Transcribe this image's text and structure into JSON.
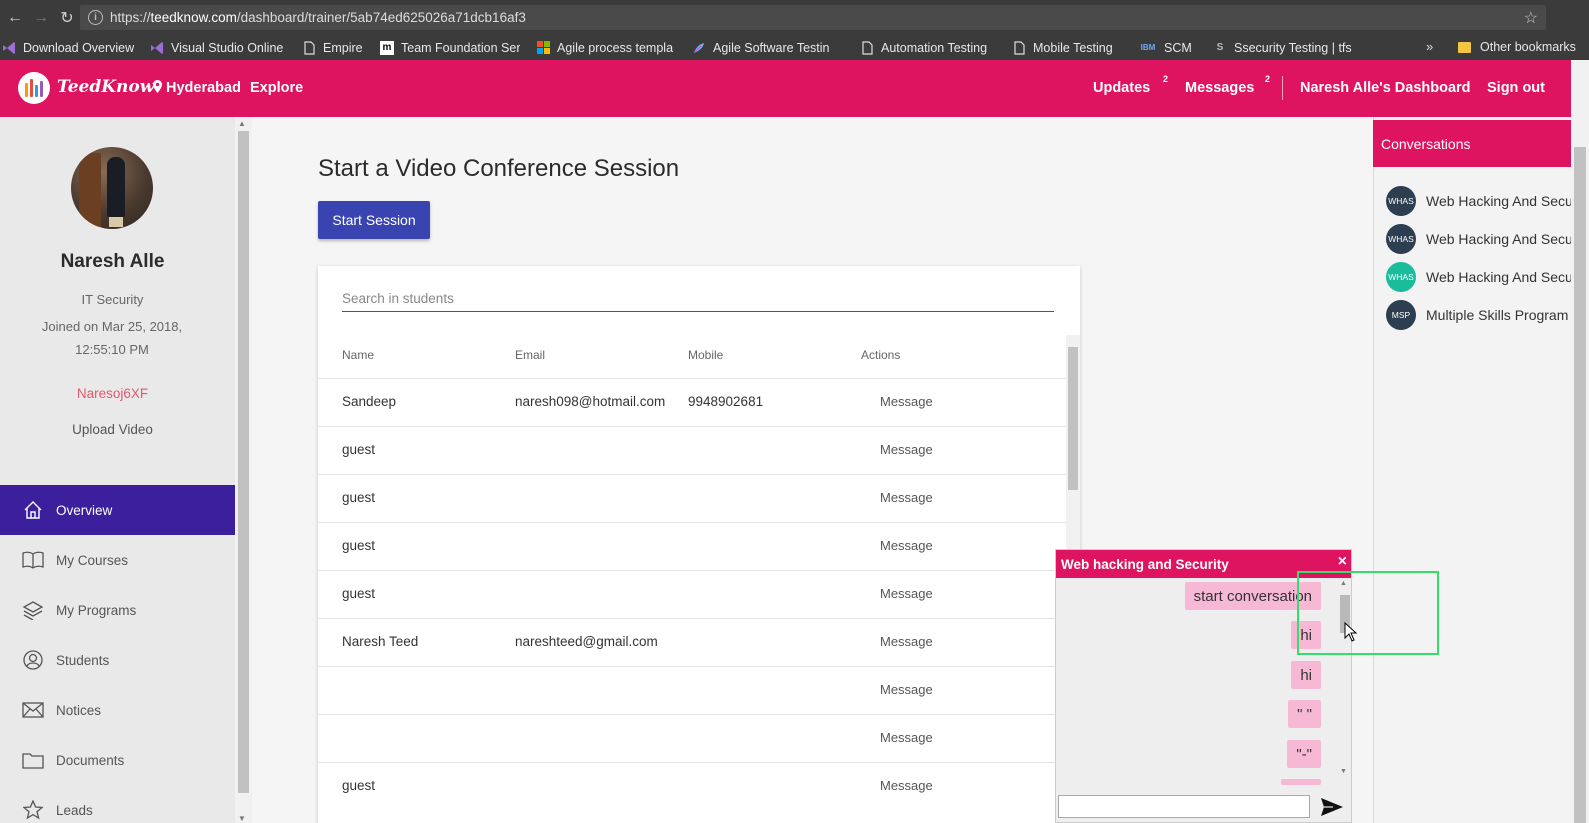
{
  "browser": {
    "url_prefix": "https://",
    "url_domain": "teedknow.com",
    "url_path": "/dashboard/trainer/5ab74ed625026a71dcb16af3",
    "bookmarks": [
      {
        "label": "Download Overview",
        "icon": "visual-studio-icon"
      },
      {
        "label": "Visual Studio Online",
        "icon": "visual-studio-icon"
      },
      {
        "label": "Empire",
        "icon": "page-icon"
      },
      {
        "label": "Team Foundation Ser",
        "icon": "m-logo-icon"
      },
      {
        "label": "Agile process templa",
        "icon": "windows-icon"
      },
      {
        "label": "Agile Software Testin",
        "icon": "feather-icon"
      },
      {
        "label": "Automation Testing",
        "icon": "page-icon"
      },
      {
        "label": "Mobile Testing",
        "icon": "page-icon"
      },
      {
        "label": "SCM",
        "icon": "ibm-icon"
      },
      {
        "label": "Ssecurity Testing | tfs",
        "icon": "s-logo-icon"
      }
    ],
    "more_label": "»",
    "other_bookmarks": "Other bookmarks"
  },
  "header": {
    "brand": "TeedKnow",
    "location": "Hyderabad",
    "explore": "Explore",
    "updates": "Updates",
    "updates_count": "2",
    "messages": "Messages",
    "messages_count": "2",
    "dashboard": "Naresh Alle's Dashboard",
    "signout": "Sign out"
  },
  "profile": {
    "name": "Naresh Alle",
    "role": "IT Security",
    "joined": "Joined on Mar 25, 2018, 12:55:10 PM",
    "code": "Naresoj6XF",
    "upload": "Upload Video"
  },
  "menu": [
    {
      "label": "Overview",
      "icon": "home-icon"
    },
    {
      "label": "My Courses",
      "icon": "book-icon"
    },
    {
      "label": "My Programs",
      "icon": "layers-icon"
    },
    {
      "label": "Students",
      "icon": "user-icon"
    },
    {
      "label": "Notices",
      "icon": "envelope-icon"
    },
    {
      "label": "Documents",
      "icon": "folder-icon"
    },
    {
      "label": "Leads",
      "icon": "star-icon"
    }
  ],
  "main": {
    "title": "Start a Video Conference Session",
    "start_button": "Start Session",
    "search_placeholder": "Search in students",
    "columns": [
      "Name",
      "Email",
      "Mobile",
      "Actions"
    ],
    "rows": [
      {
        "name": "Sandeep",
        "email": "naresh098@hotmail.com",
        "mobile": "9948902681",
        "action": "Message"
      },
      {
        "name": "guest",
        "email": "",
        "mobile": "",
        "action": "Message"
      },
      {
        "name": "guest",
        "email": "",
        "mobile": "",
        "action": "Message"
      },
      {
        "name": "guest",
        "email": "",
        "mobile": "",
        "action": "Message"
      },
      {
        "name": "guest",
        "email": "",
        "mobile": "",
        "action": "Message"
      },
      {
        "name": "Naresh Teed",
        "email": "nareshteed@gmail.com",
        "mobile": "",
        "action": "Message"
      },
      {
        "name": "",
        "email": "",
        "mobile": "",
        "action": "Message"
      },
      {
        "name": "",
        "email": "",
        "mobile": "",
        "action": "Message"
      },
      {
        "name": "guest",
        "email": "",
        "mobile": "",
        "action": "Message"
      }
    ]
  },
  "conversations": {
    "title": "Conversations",
    "items": [
      {
        "avatar": "WHAS",
        "label": "Web Hacking And Secu",
        "avatar_color": "#2c3e50"
      },
      {
        "avatar": "WHAS",
        "label": "Web Hacking And Secu",
        "avatar_color": "#2c3e50"
      },
      {
        "avatar": "WHAS",
        "label": "Web Hacking And Secu",
        "avatar_color": "#1abc9c"
      },
      {
        "avatar": "MSP",
        "label": "Multiple Skills Program",
        "avatar_color": "#2c3e50"
      }
    ]
  },
  "chat": {
    "title": "Web hacking and Security",
    "close": "×",
    "messages": [
      "start conversation",
      "hi",
      "hi",
      "\" \"",
      "\"-\""
    ],
    "input_value": ""
  },
  "colors": {
    "brand": "#df1460",
    "active_menu": "#3b1f9c",
    "primary_button": "#3a44b0",
    "chat_bubble": "#f7b8d5",
    "highlight": "#37dd6a"
  }
}
